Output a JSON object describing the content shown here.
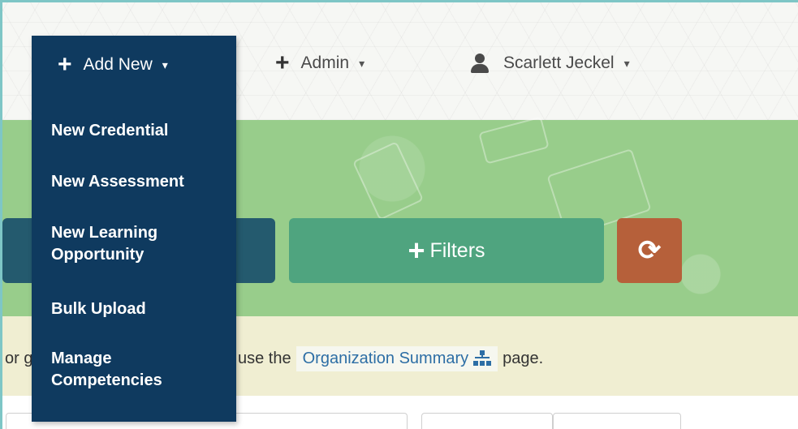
{
  "header": {
    "add_new": {
      "label": "Add New",
      "icon": "plus-icon",
      "caret": "▾"
    },
    "admin": {
      "label": "Admin",
      "icon": "plus-icon",
      "caret": "▾"
    },
    "user": {
      "name": "Scarlett Jeckel",
      "icon": "user-icon",
      "caret": "▾"
    }
  },
  "add_new_menu": {
    "items": [
      {
        "line1": "New Credential",
        "line2": ""
      },
      {
        "line1": "New Assessment",
        "line2": ""
      },
      {
        "line1": "New Learning",
        "line2": "Opportunity"
      },
      {
        "line1": "Bulk Upload",
        "line2": ""
      },
      {
        "line1": "Manage",
        "line2": "Competencies"
      }
    ]
  },
  "banner": {
    "filters_label": "Filters",
    "refresh_glyph": "⟳"
  },
  "info": {
    "text_left": "or g",
    "text_mid": "use the",
    "link_label": "Organization Summary",
    "text_end": "page."
  },
  "colors": {
    "menu_bg": "#0f3a5f",
    "banner_green": "#98cd8b",
    "filters_green": "#4fa47f",
    "refresh_orange": "#b6603a",
    "link_blue": "#2d6ea5"
  }
}
